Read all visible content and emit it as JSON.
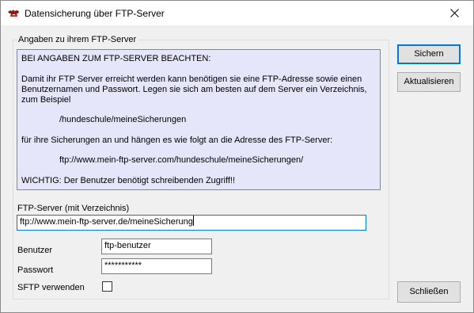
{
  "window": {
    "title": "Datensicherung über FTP-Server",
    "app_icon": "dog-silhouette-icon",
    "close_icon": "close-icon"
  },
  "group": {
    "legend": "Angaben zu ihrem FTP-Server"
  },
  "info": {
    "lines": [
      "BEI ANGABEN ZUM FTP-SERVER BEACHTEN:",
      "Damit ihr FTP Server erreicht werden kann benötigen sie eine FTP-Adresse sowie einen",
      "Benutzernamen und Passwort. Legen sie sich am besten auf dem Server ein Verzeichnis,",
      "zum Beispiel",
      "/hundeschule/meineSicherungen",
      "für ihre Sicherungen an und hängen es wie folgt an die Adresse des FTP-Server:",
      "ftp://www.mein-ftp-server.com/hundeschule/meineSicherungen/",
      "WICHTIG: Der Benutzer benötigt schreibenden Zugriff!!"
    ]
  },
  "form": {
    "server_label": "FTP-Server (mit Verzeichnis)",
    "server_value": "ftp://www.mein-ftp-server.de/meineSicherung",
    "user_label": "Benutzer",
    "user_value": "ftp-benutzer",
    "password_label": "Passwort",
    "password_value": "***********",
    "sftp_label": "SFTP verwenden",
    "sftp_checked": false
  },
  "buttons": {
    "save": "Sichern",
    "refresh": "Aktualisieren",
    "close": "Schließen"
  },
  "colors": {
    "info_background": "#e6e6fa",
    "focus_accent": "#0078d7"
  }
}
